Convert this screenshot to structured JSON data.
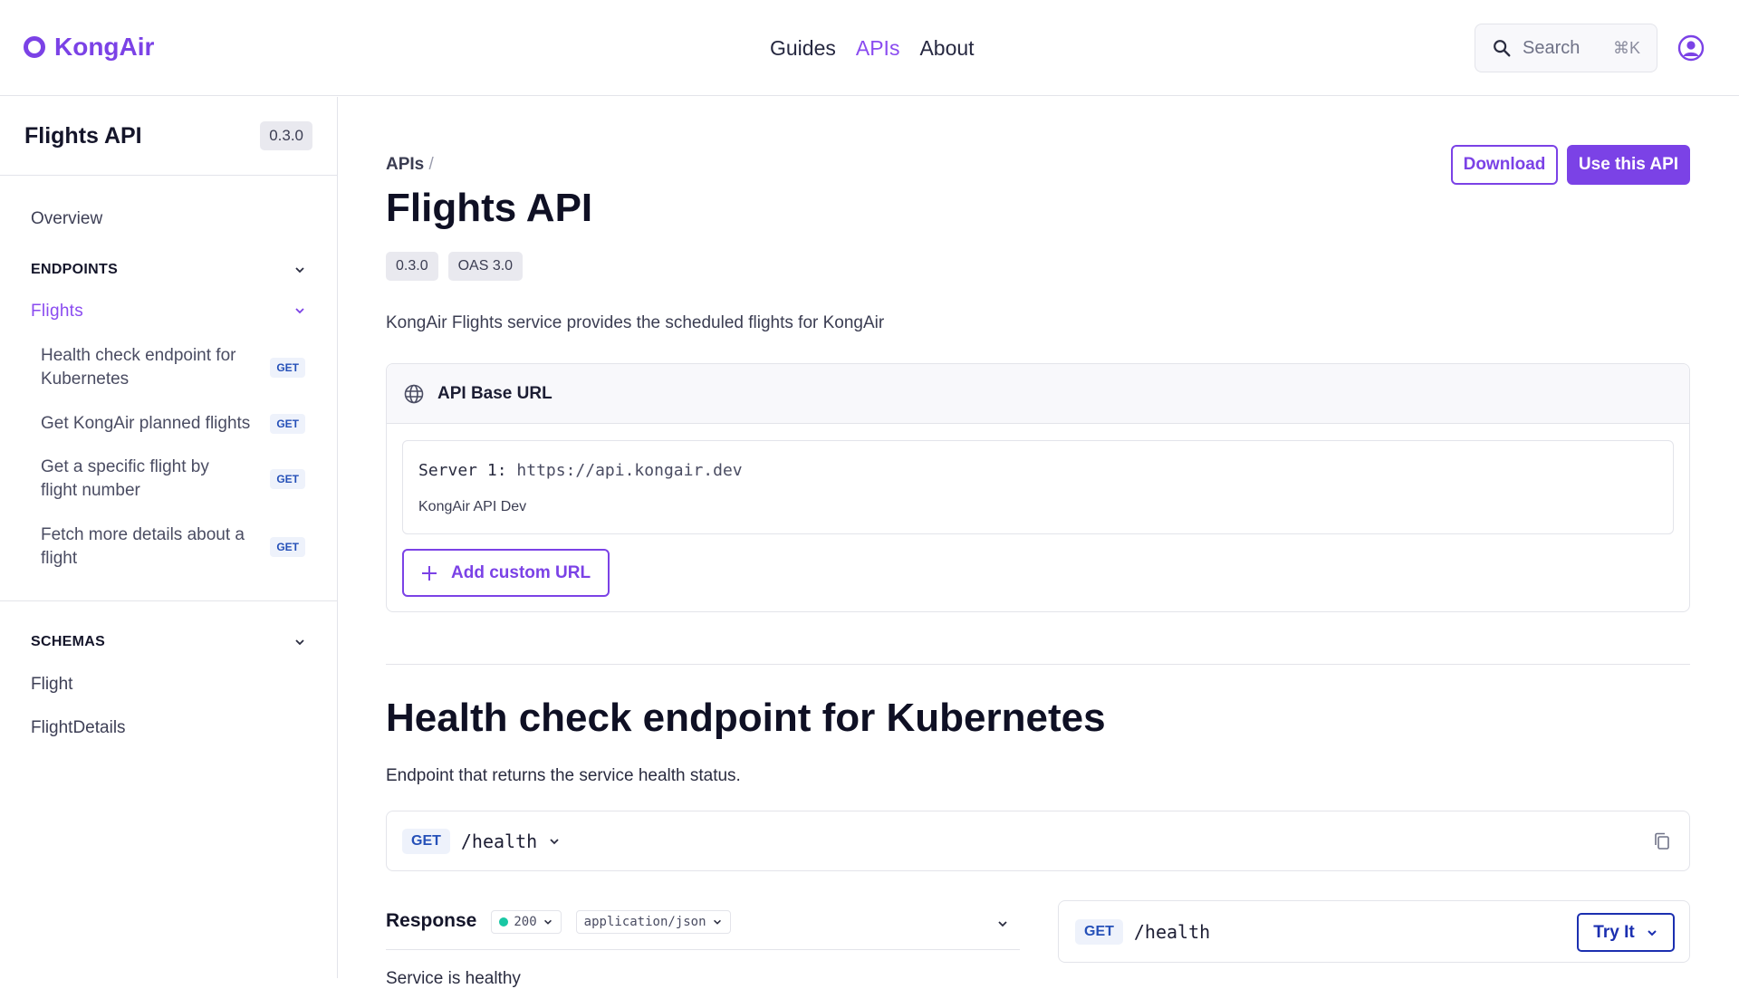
{
  "brand": {
    "name": "KongAir"
  },
  "topnav": {
    "guides": "Guides",
    "apis": "APIs",
    "about": "About"
  },
  "search": {
    "label": "Search",
    "shortcut": "⌘K"
  },
  "sidebar": {
    "title": "Flights API",
    "version": "0.3.0",
    "overview": "Overview",
    "endpoints_heading": "ENDPOINTS",
    "flights_group": "Flights",
    "endpoints": [
      {
        "label": "Health check endpoint for Kubernetes",
        "method": "GET"
      },
      {
        "label": "Get KongAir planned flights",
        "method": "GET"
      },
      {
        "label": "Get a specific flight by flight number",
        "method": "GET"
      },
      {
        "label": "Fetch more details about a flight",
        "method": "GET"
      }
    ],
    "schemas_heading": "SCHEMAS",
    "schemas": [
      "Flight",
      "FlightDetails"
    ]
  },
  "main": {
    "breadcrumb": "APIs",
    "breadcrumb_sep": "/",
    "title": "Flights API",
    "version_badge": "0.3.0",
    "oas_badge": "OAS 3.0",
    "download_label": "Download",
    "use_label": "Use this API",
    "description": "KongAir Flights service provides the scheduled flights for KongAir",
    "base_url": {
      "title": "API Base URL",
      "server_label": "Server 1:",
      "server_url": "https://api.kongair.dev",
      "server_desc": "KongAir API Dev",
      "add_label": "Add custom URL"
    },
    "endpoint": {
      "title": "Health check endpoint for Kubernetes",
      "description": "Endpoint that returns the service health status.",
      "method": "GET",
      "path": "/health"
    },
    "response": {
      "title": "Response",
      "status": "200",
      "content_type": "application/json",
      "status_color": "#19c7a4",
      "partial_text": "Service is healthy"
    },
    "try": {
      "method": "GET",
      "path": "/health",
      "label": "Try It"
    }
  },
  "colors": {
    "accent": "#7b42e6",
    "try_blue": "#1b2fb0",
    "get_blue": "#2550b8"
  }
}
